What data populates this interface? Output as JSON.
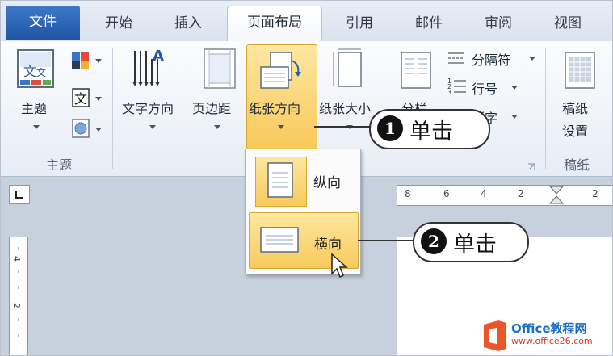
{
  "tabs": [
    "文件",
    "开始",
    "插入",
    "页面布局",
    "引用",
    "邮件",
    "审阅",
    "视图"
  ],
  "ribbon": {
    "theme": {
      "label": "主题",
      "group": "主题"
    },
    "text_direction": "文字方向",
    "margins": "页边距",
    "orientation": "纸张方向",
    "size": "纸张大小",
    "columns": "分栏",
    "breaks": "分隔符",
    "line_numbers": "行号",
    "hyphenation": "断字",
    "manuscript": {
      "line1": "稿纸",
      "line2": "设置",
      "group": "稿纸"
    }
  },
  "dropdown": {
    "portrait": "纵向",
    "landscape": "横向"
  },
  "ruler": {
    "numbers": [
      "8",
      "6",
      "4",
      "2",
      "2"
    ],
    "vnumbers": [
      "4",
      "2"
    ]
  },
  "callouts": [
    {
      "num": "1",
      "text": "单击"
    },
    {
      "num": "2",
      "text": "单击"
    }
  ],
  "watermark": {
    "brand": "Office教程网",
    "url": "www.office26.com"
  },
  "colors": {
    "accent": "#1f56a6",
    "highlight": "#f8c95a",
    "doc_bg": "#c7d1de"
  }
}
